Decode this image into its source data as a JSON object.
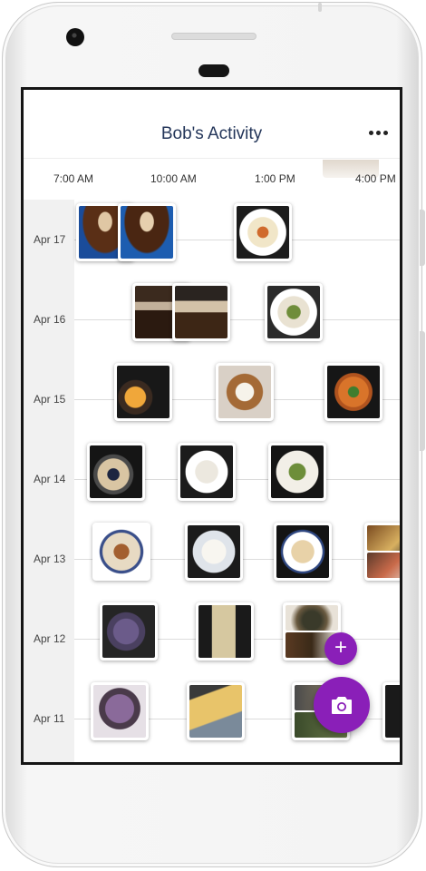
{
  "header": {
    "title": "Bob's Activity",
    "menu_icon": "more-horizontal-icon"
  },
  "time_axis": [
    "7:00 AM",
    "10:00 AM",
    "1:00 PM",
    "4:00 PM"
  ],
  "days": [
    {
      "label": "Apr 17",
      "meals": [
        "coffee",
        "coffee",
        "breakfast plate with salad"
      ]
    },
    {
      "label": "Apr 16",
      "meals": [
        "layered drink",
        "layered drink",
        "plate with greens and avocado"
      ]
    },
    {
      "label": "Apr 15",
      "meals": [
        "mango bowl with drink",
        "rice in bowl",
        "vegetable bowl"
      ]
    },
    {
      "label": "Apr 14",
      "meals": [
        "blueberry oatmeal",
        "rice plate",
        "avocado plate"
      ]
    },
    {
      "label": "Apr 13",
      "meals": [
        "plate with sauce",
        "rice plate",
        "plate with dumplings",
        "mixed plate"
      ]
    },
    {
      "label": "Apr 12",
      "meals": [
        "purple smoothie",
        "glass of milk",
        "mixed dish"
      ]
    },
    {
      "label": "Apr 11",
      "meals": [
        "purple dessert",
        "snack bag",
        "mixed dish",
        "drink"
      ]
    }
  ],
  "actions": {
    "add_icon": "plus-icon",
    "camera_icon": "camera-icon"
  },
  "colors": {
    "accent": "#8a1fb8",
    "title": "#24365a"
  }
}
